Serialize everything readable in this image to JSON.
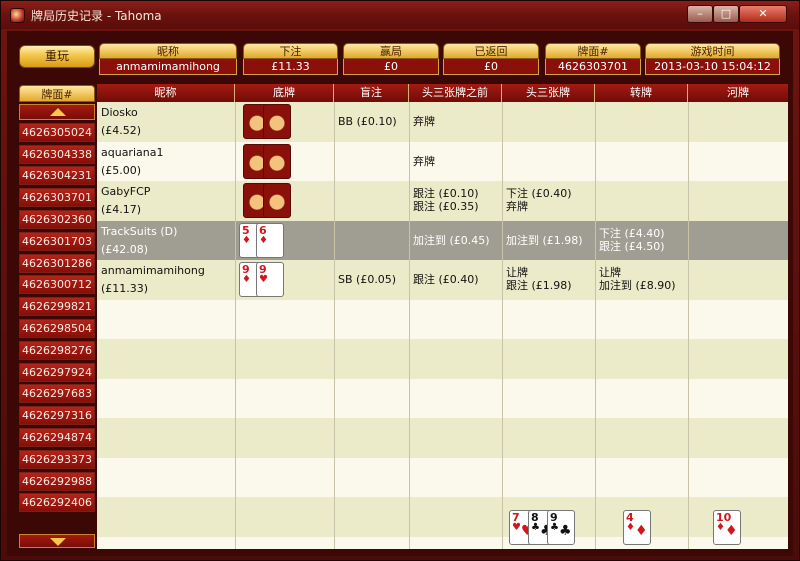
{
  "window": {
    "title": "牌局历史记录 - Tahoma",
    "min": "–",
    "max": "□",
    "close": "✕"
  },
  "replay_label": "重玩",
  "header": [
    {
      "label": "昵称",
      "value": "anmamimamihong"
    },
    {
      "label": "下注",
      "value": "£11.33"
    },
    {
      "label": "赢局",
      "value": "£0"
    },
    {
      "label": "已返回",
      "value": "£0"
    },
    {
      "label": "牌面#",
      "value": "4626303701"
    },
    {
      "label": "游戏时间",
      "value": "2013-03-10 15:04:12"
    }
  ],
  "hand_list": {
    "header": "牌面#",
    "items": [
      "4626305024",
      "4626304338",
      "4626304231",
      "4626303701",
      "4626302360",
      "4626301703",
      "4626301286",
      "4626300712",
      "4626299821",
      "4626298504",
      "4626298276",
      "4626297924",
      "4626297683",
      "4626297316",
      "4626294874",
      "4626293373",
      "4626292988",
      "4626292406"
    ]
  },
  "table": {
    "columns": [
      "昵称",
      "底牌",
      "盲注",
      "头三张牌之前",
      "头三张牌",
      "转牌",
      "河牌"
    ],
    "rows": [
      {
        "name": "Diosko",
        "stack": "(£4.52)",
        "blind": "BB (£0.10)",
        "preflop": "弃牌",
        "flop": "",
        "turn": "",
        "river": "",
        "cards": "back"
      },
      {
        "name": "aquariana1",
        "stack": "(£5.00)",
        "blind": "",
        "preflop": "弃牌",
        "flop": "",
        "turn": "",
        "river": "",
        "cards": "back"
      },
      {
        "name": "GabyFCP",
        "stack": "(£4.17)",
        "blind": "",
        "preflop": "跟注 (£0.10)\n跟注 (£0.35)",
        "flop": "下注 (£0.40)\n弃牌",
        "turn": "",
        "river": "",
        "cards": "back"
      },
      {
        "name": "TrackSuits (D)",
        "stack": "(£42.08)",
        "blind": "",
        "preflop": "加注到 (£0.45)",
        "flop": "加注到 (£1.98)",
        "turn": "下注 (£4.40)\n跟注 (£4.50)",
        "river": "",
        "cards": "5-6"
      },
      {
        "name": "anmamimamihong",
        "stack": "(£11.33)",
        "blind": "SB (£0.05)",
        "preflop": "跟注 (£0.40)",
        "flop": "让牌\n跟注 (£1.98)",
        "turn": "让牌\n加注到 (£8.90)",
        "river": "",
        "cards": "9-9"
      }
    ],
    "hole_cards": {
      "TrackSuits": [
        {
          "rank": "5",
          "suit": "♦",
          "color": "red"
        },
        {
          "rank": "6",
          "suit": "♦",
          "color": "red"
        }
      ],
      "anmamimamihong": [
        {
          "rank": "9",
          "suit": "♦",
          "color": "red"
        },
        {
          "rank": "9",
          "suit": "♥",
          "color": "red"
        }
      ]
    },
    "board": {
      "flop": [
        {
          "rank": "7",
          "suit": "♥",
          "color": "red"
        },
        {
          "rank": "8",
          "suit": "♣",
          "color": "black"
        },
        {
          "rank": "9",
          "suit": "♣",
          "color": "black"
        }
      ],
      "turn": [
        {
          "rank": "4",
          "suit": "♦",
          "color": "red"
        }
      ],
      "river": [
        {
          "rank": "10",
          "suit": "♦",
          "color": "red"
        }
      ]
    }
  }
}
